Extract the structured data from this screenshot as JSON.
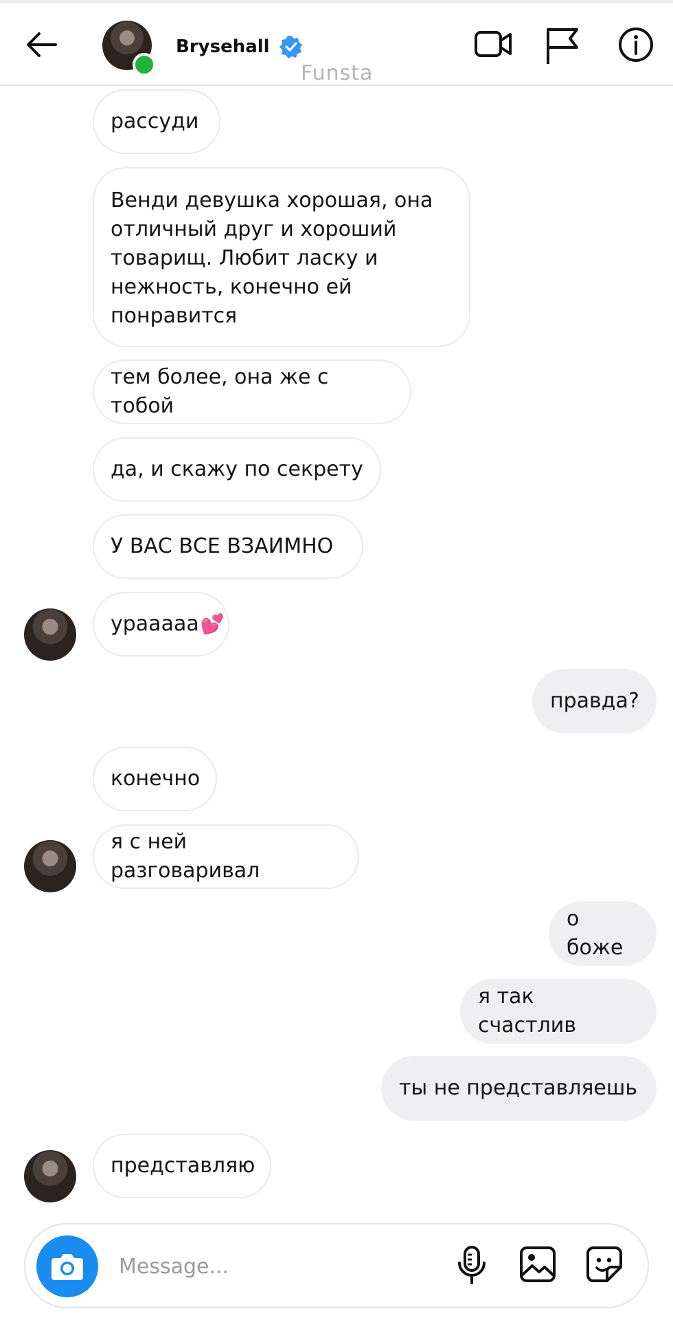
{
  "header": {
    "username": "Brysehall",
    "watermark": "Funsta"
  },
  "messages": [
    {
      "text": "рассуди",
      "dir": "in"
    },
    {
      "text": "Венди девушка хорошая, она отличный друг и хороший товарищ. Любит ласку и нежность, конечно ей понравится",
      "dir": "in"
    },
    {
      "text": "тем более, она же с тобой",
      "dir": "in"
    },
    {
      "text": "да, и скажу по секрету",
      "dir": "in"
    },
    {
      "text": "У ВАС ВСЕ ВЗАИМНО",
      "dir": "in"
    },
    {
      "text": "урааааа",
      "dir": "in"
    },
    {
      "text": "правда?",
      "dir": "out"
    },
    {
      "text": "конечно",
      "dir": "in"
    },
    {
      "text": "я с ней разговаривал",
      "dir": "in"
    },
    {
      "text": "о боже",
      "dir": "out"
    },
    {
      "text": "я так счастлив",
      "dir": "out"
    },
    {
      "text": "ты не представляешь",
      "dir": "out"
    },
    {
      "text": "представляю",
      "dir": "in"
    }
  ],
  "emoji": {
    "heart": "💕"
  },
  "composer": {
    "placeholder": "Message..."
  },
  "colors": {
    "accent": "#1a8cf0",
    "online": "#23b33a",
    "outgoing_bubble": "#efeff1"
  }
}
